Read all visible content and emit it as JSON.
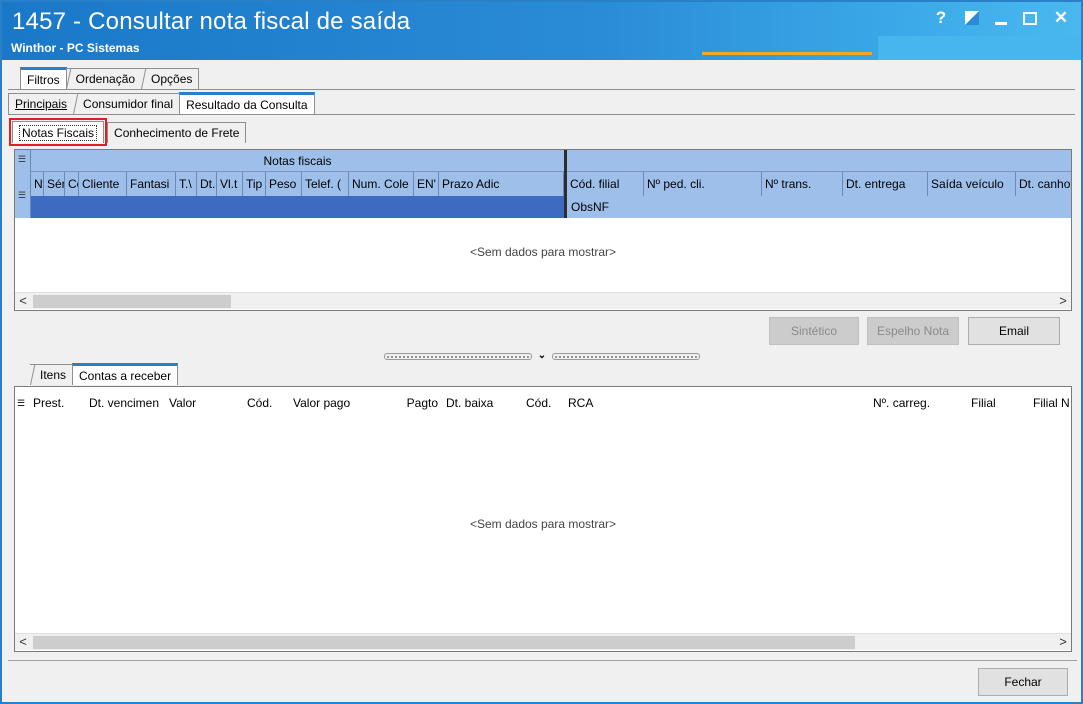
{
  "window": {
    "title": "1457 - Consultar nota fiscal de saída",
    "subtitle": "Winthor - PC Sistemas",
    "help_label": "?",
    "close_label": "✕"
  },
  "tabs_top": [
    {
      "label": "Filtros",
      "active": true
    },
    {
      "label": "Ordenação",
      "active": false
    },
    {
      "label": "Opções",
      "active": false
    }
  ],
  "tabs_second": [
    {
      "label": "Principais",
      "active": false
    },
    {
      "label": "Consumidor final",
      "active": false
    },
    {
      "label": "Resultado da Consulta",
      "active": true
    }
  ],
  "tabs_result": [
    {
      "label": "Notas Fiscais",
      "active": true,
      "highlighted": true
    },
    {
      "label": "Conhecimento de Frete",
      "active": false
    }
  ],
  "grid_nf": {
    "band_title": "Notas fiscais",
    "columns_left": [
      "Nº",
      "Sér",
      "Cóc",
      "Cliente",
      "Fantasi",
      "T.\\",
      "Dt.",
      "Vl.t",
      "Tip",
      "Peso",
      "Telef. (",
      "Num. Cole",
      "EN'",
      "Prazo Adic"
    ],
    "columns_right": [
      "Cód. filial",
      "Nº ped. cli.",
      "Nº trans.",
      "Dt. entrega",
      "Saída veículo",
      "Dt. canho"
    ],
    "obs_label": "ObsNF",
    "empty_text": "<Sem dados para mostrar>"
  },
  "buttons": {
    "sintetico": "Sintético",
    "espelho": "Espelho Nota",
    "email": "Email",
    "fechar": "Fechar"
  },
  "tabs_bottom": [
    {
      "label": "Itens",
      "active": false
    },
    {
      "label": "Contas a receber",
      "active": true
    }
  ],
  "grid_contas": {
    "columns": [
      "Prest.",
      "Dt. vencimen",
      "Valor",
      "Cód.",
      "Valor pago",
      "Pagto",
      "Dt. baixa",
      "Cód.",
      "RCA",
      "Nº. carreg.",
      "Filial",
      "Filial N"
    ],
    "empty_text": "<Sem dados para mostrar>"
  },
  "colors": {
    "titlebar": "#2a8bd6",
    "grid_header": "#9ebfea",
    "selected_row": "#3c6bc1",
    "highlight": "#e02020"
  }
}
